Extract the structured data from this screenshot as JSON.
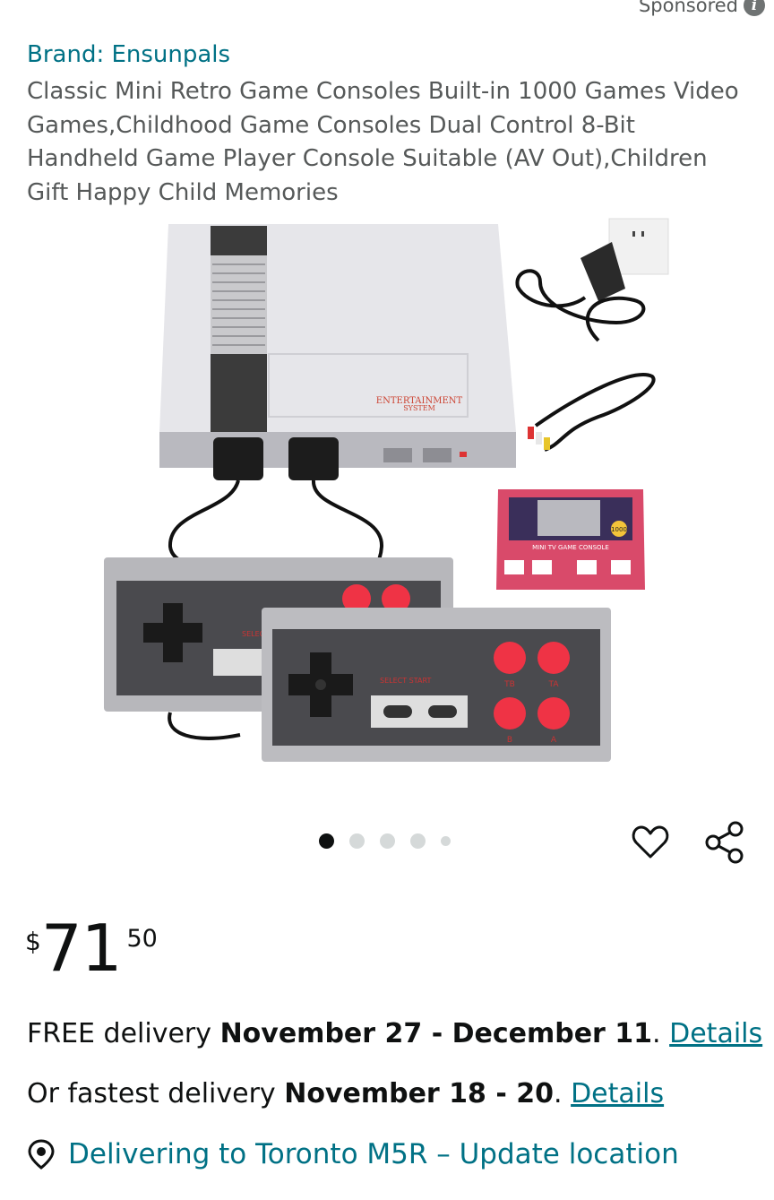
{
  "sponsored": {
    "label": "Sponsored",
    "icon": "info-icon"
  },
  "product": {
    "brand_label": "Brand: Ensunpals",
    "title": "Classic Mini Retro Game Consoles Built-in 1000 Games Video Games,Childhood Game Consoles Dual Control 8-Bit Handheld Game Player Console Suitable (AV Out),Children Gift Happy Child Memories",
    "image_labels": {
      "console_brand": "ENTERTAINMENT",
      "console_sub": "SYSTEM",
      "box_label": "MINI TV GAME CONSOLE",
      "box_count": "1000",
      "controller_front_label": "SELECT START",
      "controller_back_label": "SELECT",
      "button_ta": "TA",
      "button_tb": "TB",
      "button_a": "A",
      "button_b": "B"
    }
  },
  "carousel": {
    "count": 5,
    "active_index": 0
  },
  "actions": {
    "wishlist_icon": "heart-icon",
    "share_icon": "share-icon"
  },
  "price": {
    "symbol": "$",
    "whole": "71",
    "fraction": "50"
  },
  "delivery": {
    "free_prefix": "FREE delivery ",
    "free_dates": "November 27 - December 11",
    "free_suffix": ". ",
    "free_link": "Details",
    "fast_prefix": "Or fastest delivery ",
    "fast_dates": "November 18 - 20",
    "fast_suffix": ". ",
    "fast_link": "Details"
  },
  "location": {
    "text": "Delivering to Toronto M5R – Update location",
    "icon": "location-pin-icon"
  },
  "colors": {
    "link": "#007185",
    "text": "#0f1111",
    "muted": "#565959",
    "button_red": "#ef3345"
  }
}
